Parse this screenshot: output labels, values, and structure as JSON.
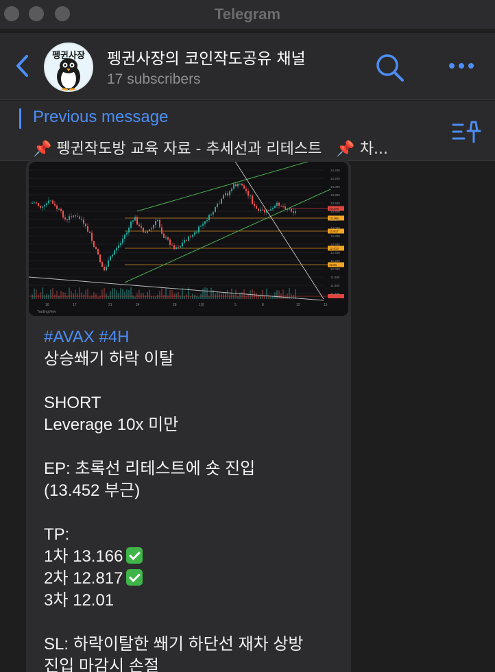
{
  "window": {
    "title": "Telegram"
  },
  "header": {
    "channel_name": "펭귄사장의 코인작도공유 채널",
    "subscribers": "17 subscribers",
    "avatar_text": "펭귄사장"
  },
  "pinned": {
    "title": "Previous message",
    "pin_emoji": "📌",
    "text": "펭귄작도방 교육 자료  - 추세선과 리테스트",
    "text_more": "차..."
  },
  "chart": {
    "footer": "TradingView",
    "x_ticks": [
      "16",
      "17",
      "21",
      "24",
      "28",
      "1월",
      "5",
      "8",
      "12",
      "15"
    ],
    "price_ticks": [
      "14.400",
      "14.200",
      "14.000",
      "13.800",
      "13.600",
      "13.400",
      "13.200",
      "13.000",
      "12.800",
      "12.600",
      "12.400",
      "12.200",
      "12.000",
      "11.800",
      "11.600",
      "11.400"
    ],
    "level_tags": [
      {
        "label": "13.166",
        "color": "#f5a623"
      },
      {
        "label": "12.817",
        "color": "#f5a623"
      },
      {
        "label": "12.413",
        "color": "#f5a623"
      },
      {
        "label": "12.01",
        "color": "#f5a623"
      },
      {
        "label": "13.378",
        "color": "#e0443e"
      }
    ]
  },
  "message": {
    "hashtags": "#AVAX #4H",
    "l1": "상승쐐기 하락 이탈",
    "l2": "SHORT",
    "l3": "Leverage 10x 미만",
    "l4": "EP: 초록선 리테스트에 숏 진입",
    "l5": "(13.452 부근)",
    "l6": "TP:",
    "l7": "1차 13.166",
    "l8": "2차 12.817",
    "l9": "3차 12.01",
    "l10": "SL: 하락이탈한 쐐기 하단선 재차 상방",
    "l11": "진입 마감시 손절"
  },
  "colors": {
    "accent": "#4c8ef7",
    "bubble": "#2c2c2e",
    "background": "#1e1e1e"
  }
}
